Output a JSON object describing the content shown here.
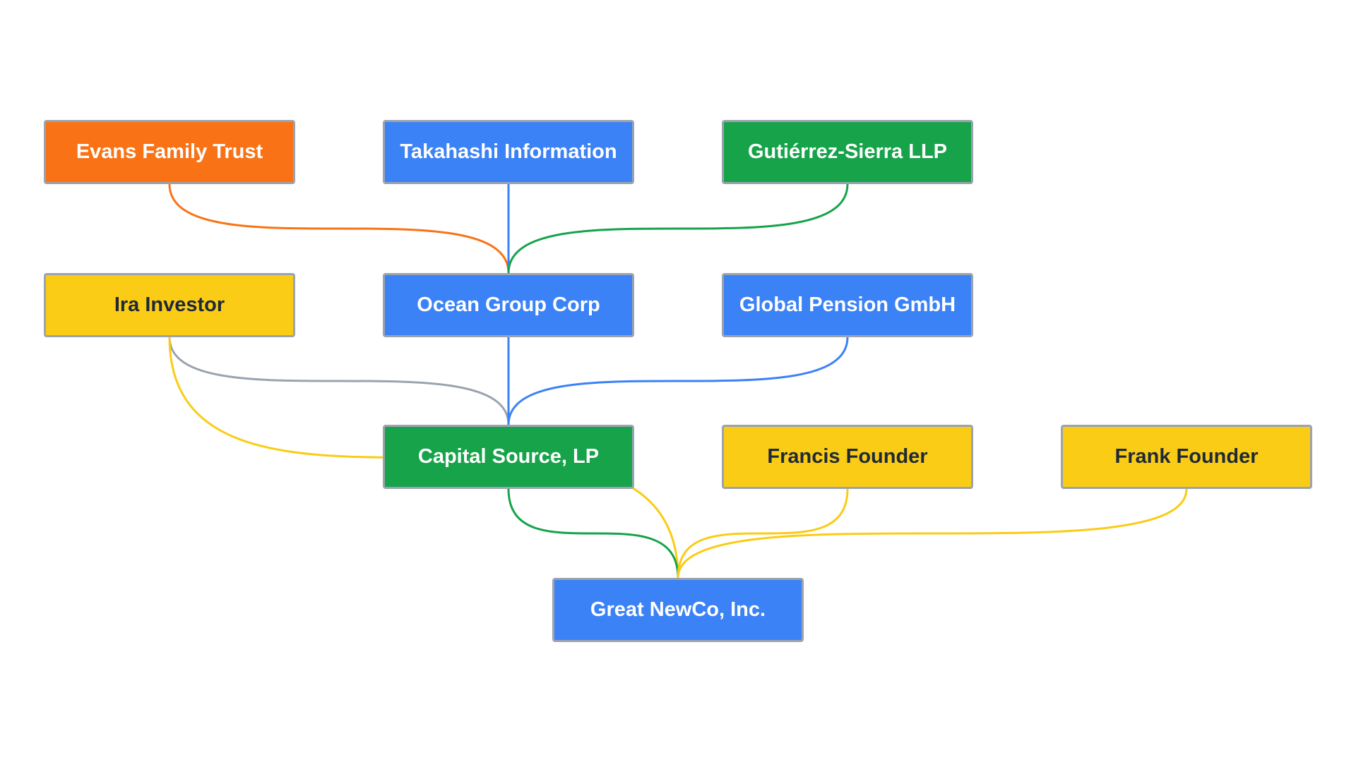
{
  "colors": {
    "orange": "#f97316",
    "blue": "#3b82f6",
    "green": "#16a34a",
    "yellow": "#facc15",
    "gray": "#9ca3af"
  },
  "nodes": [
    {
      "id": "evans",
      "label": "Evans Family Trust",
      "color": "orange"
    },
    {
      "id": "takahashi",
      "label": "Takahashi Information",
      "color": "blue"
    },
    {
      "id": "gutierrez",
      "label": "Gutiérrez-Sierra LLP",
      "color": "green"
    },
    {
      "id": "ira",
      "label": "Ira Investor",
      "color": "yellow"
    },
    {
      "id": "ocean",
      "label": "Ocean Group Corp",
      "color": "blue"
    },
    {
      "id": "global",
      "label": "Global Pension GmbH",
      "color": "blue"
    },
    {
      "id": "capital",
      "label": "Capital Source, LP",
      "color": "green"
    },
    {
      "id": "francis",
      "label": "Francis Founder",
      "color": "yellow"
    },
    {
      "id": "frank",
      "label": "Frank Founder",
      "color": "yellow"
    },
    {
      "id": "newco",
      "label": "Great NewCo, Inc.",
      "color": "blue"
    }
  ],
  "edges": [
    {
      "from": "evans",
      "to": "ocean",
      "color": "orange"
    },
    {
      "from": "takahashi",
      "to": "ocean",
      "color": "blue"
    },
    {
      "from": "gutierrez",
      "to": "ocean",
      "color": "green"
    },
    {
      "from": "ira",
      "to": "capital",
      "color": "gray"
    },
    {
      "from": "ocean",
      "to": "capital",
      "color": "blue"
    },
    {
      "from": "global",
      "to": "capital",
      "color": "blue"
    },
    {
      "from": "ira",
      "to": "newco",
      "color": "yellow"
    },
    {
      "from": "capital",
      "to": "newco",
      "color": "green"
    },
    {
      "from": "francis",
      "to": "newco",
      "color": "yellow"
    },
    {
      "from": "frank",
      "to": "newco",
      "color": "yellow"
    }
  ]
}
